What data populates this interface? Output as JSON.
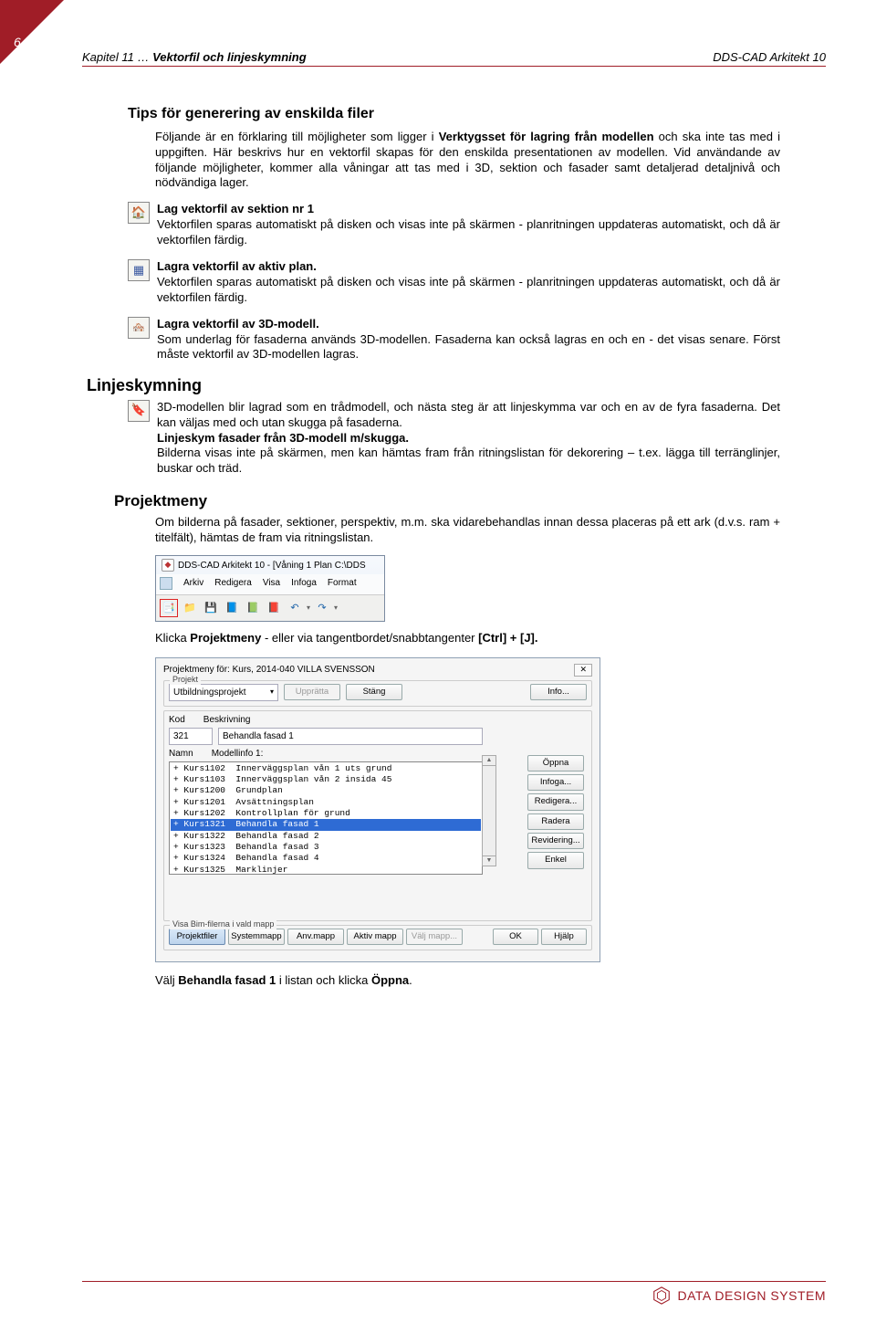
{
  "page_number": "6",
  "header": {
    "left_prefix": "Kapitel 11 … ",
    "left_bold": "Vektorfil och linjeskymning",
    "right": "DDS-CAD Arkitekt 10"
  },
  "tips_heading": "Tips för generering av enskilda filer",
  "tips_p1": "Följande är en förklaring till möjligheter som ligger i ",
  "tips_p1_b": "Verktygsset för lagring från modellen",
  "tips_p1_end": " och ska inte tas med i uppgiften. Här beskrivs hur en vektorfil skapas för den enskilda presentationen av modellen. Vid användande av följande möjligheter, kommer alla våningar att tas med i 3D, sektion och fasader samt detaljerad detaljnivå och nödvändiga lager.",
  "s1_t": "Lag vektorfil av sektion nr 1",
  "s1_b": "Vektorfilen sparas automatiskt på disken och visas inte på skärmen - planritningen uppdateras automatiskt, och då är vektorfilen färdig.",
  "s2_t": "Lagra vektorfil av aktiv plan",
  "s2_b": "Vektorfilen sparas automatiskt på disken och visas inte på skärmen - planritningen uppdateras automatiskt, och då är vektorfilen färdig.",
  "s3_t": "Lagra vektorfil av 3D-modell",
  "s3_b": "Som underlag för fasaderna används 3D-modellen. Fasaderna kan också lagras en och en - det visas senare. Först måste vektorfil av 3D-modellen lagras.",
  "h_linje": "Linjeskymning",
  "lin_1": "3D-modellen blir lagrad som en trådmodell, och nästa steg är att linjeskymma var och en av de fyra fasaderna. Det kan väljas med och utan skugga på fasaderna.",
  "lin_b": "Linjeskym fasader från 3D-modell m/skugga",
  "lin_2": "Bilderna visas inte på skärmen, men kan hämtas fram från ritningslistan för dekorering – t.ex. lägga till terränglinjer, buskar och träd.",
  "h_proj": "Projektmeny",
  "proj_p": "Om bilderna på fasader, sektioner, perspektiv, m.m. ska vidarebehandlas innan dessa placeras på ett ark (d.v.s. ram + titelfält), hämtas de fram via ritningslistan.",
  "shot1": {
    "title": "DDS-CAD Arkitekt 10 - [Våning 1  Plan  C:\\DDS",
    "menu": [
      "Arkiv",
      "Redigera",
      "Visa",
      "Infoga",
      "Format"
    ]
  },
  "click_line_a": "Klicka ",
  "click_line_b": "Projektmeny",
  "click_line_c": " - eller via tangentbordet/snabbtangenter ",
  "click_line_d": "[Ctrl] + [J].",
  "shot2": {
    "title": "Projektmeny för:  Kurs,  2014-040 VILLA SVENSSON",
    "g_proj": "Projekt",
    "dd": "Utbildningsprojekt",
    "btn_upp": "Upprätta",
    "btn_stang": "Stäng",
    "btn_info": "Info...",
    "lbl_kod": "Kod",
    "lbl_bes": "Beskrivning",
    "kod": "321",
    "bes": "Behandla fasad 1",
    "lbl_namn": "Namn",
    "lbl_mi": "Modellinfo 1:",
    "rows": [
      "+ Kurs1102  Innerväggsplan vån 1 uts grund",
      "+ Kurs1103  Innerväggsplan vån 2 insida 45",
      "+ Kurs1200  Grundplan",
      "+ Kurs1201  Avsättningsplan",
      "+ Kurs1202  Kontrollplan för grund",
      "+ Kurs1321  Behandla fasad 1",
      "+ Kurs1322  Behandla fasad 2",
      "+ Kurs1323  Behandla fasad 3",
      "+ Kurs1324  Behandla fasad 4",
      "+ Kurs1325  Marklinjer"
    ],
    "side": [
      "Öppna",
      "Infoga...",
      "Redigera...",
      "Radera",
      "Revidering...",
      "Enkel"
    ],
    "g_visa": "Visa Bim-filerna i vald mapp",
    "bim": [
      "Projektfiler",
      "Systemmapp",
      "Anv.mapp",
      "Aktiv mapp",
      "Välj mapp..."
    ],
    "ok": "OK",
    "help": "Hjälp"
  },
  "pick_a": "Välj ",
  "pick_b": "Behandla fasad 1",
  "pick_c": " i listan och klicka ",
  "pick_d": "Öppna",
  "pick_e": ".",
  "footer": "DATA DESIGN SYSTEM"
}
